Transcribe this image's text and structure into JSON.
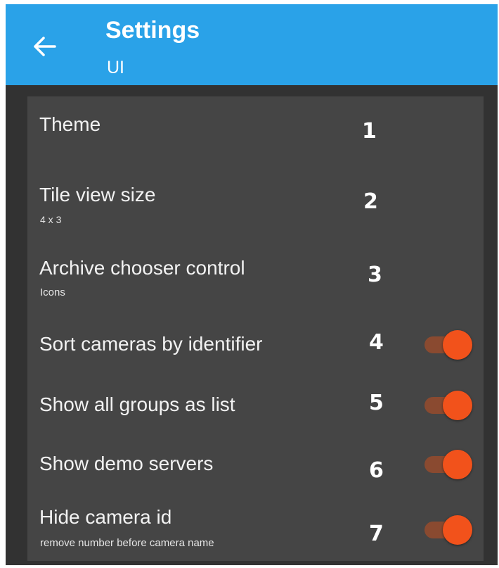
{
  "header": {
    "title": "Settings",
    "subtitle": "UI",
    "back_icon": "arrow-left-icon"
  },
  "colors": {
    "appbar": "#2aa2e8",
    "background": "#323232",
    "panel": "#454545",
    "toggle_thumb": "#f2521b",
    "toggle_track": "#8a4a30"
  },
  "settings": [
    {
      "title": "Theme",
      "subtitle": "",
      "marker": "1"
    },
    {
      "title": "Tile view size",
      "subtitle": "4 x 3",
      "marker": "2"
    },
    {
      "title": "Archive chooser control",
      "subtitle": "Icons",
      "marker": "3"
    },
    {
      "title": "Sort cameras by identifier",
      "subtitle": "",
      "marker": "4",
      "toggle": true
    },
    {
      "title": "Show all groups as list",
      "subtitle": "",
      "marker": "5",
      "toggle": true
    },
    {
      "title": "Show demo servers",
      "subtitle": "",
      "marker": "6",
      "toggle": true
    },
    {
      "title": "Hide camera id",
      "subtitle": "remove number before camera name",
      "marker": "7",
      "toggle": true
    }
  ]
}
